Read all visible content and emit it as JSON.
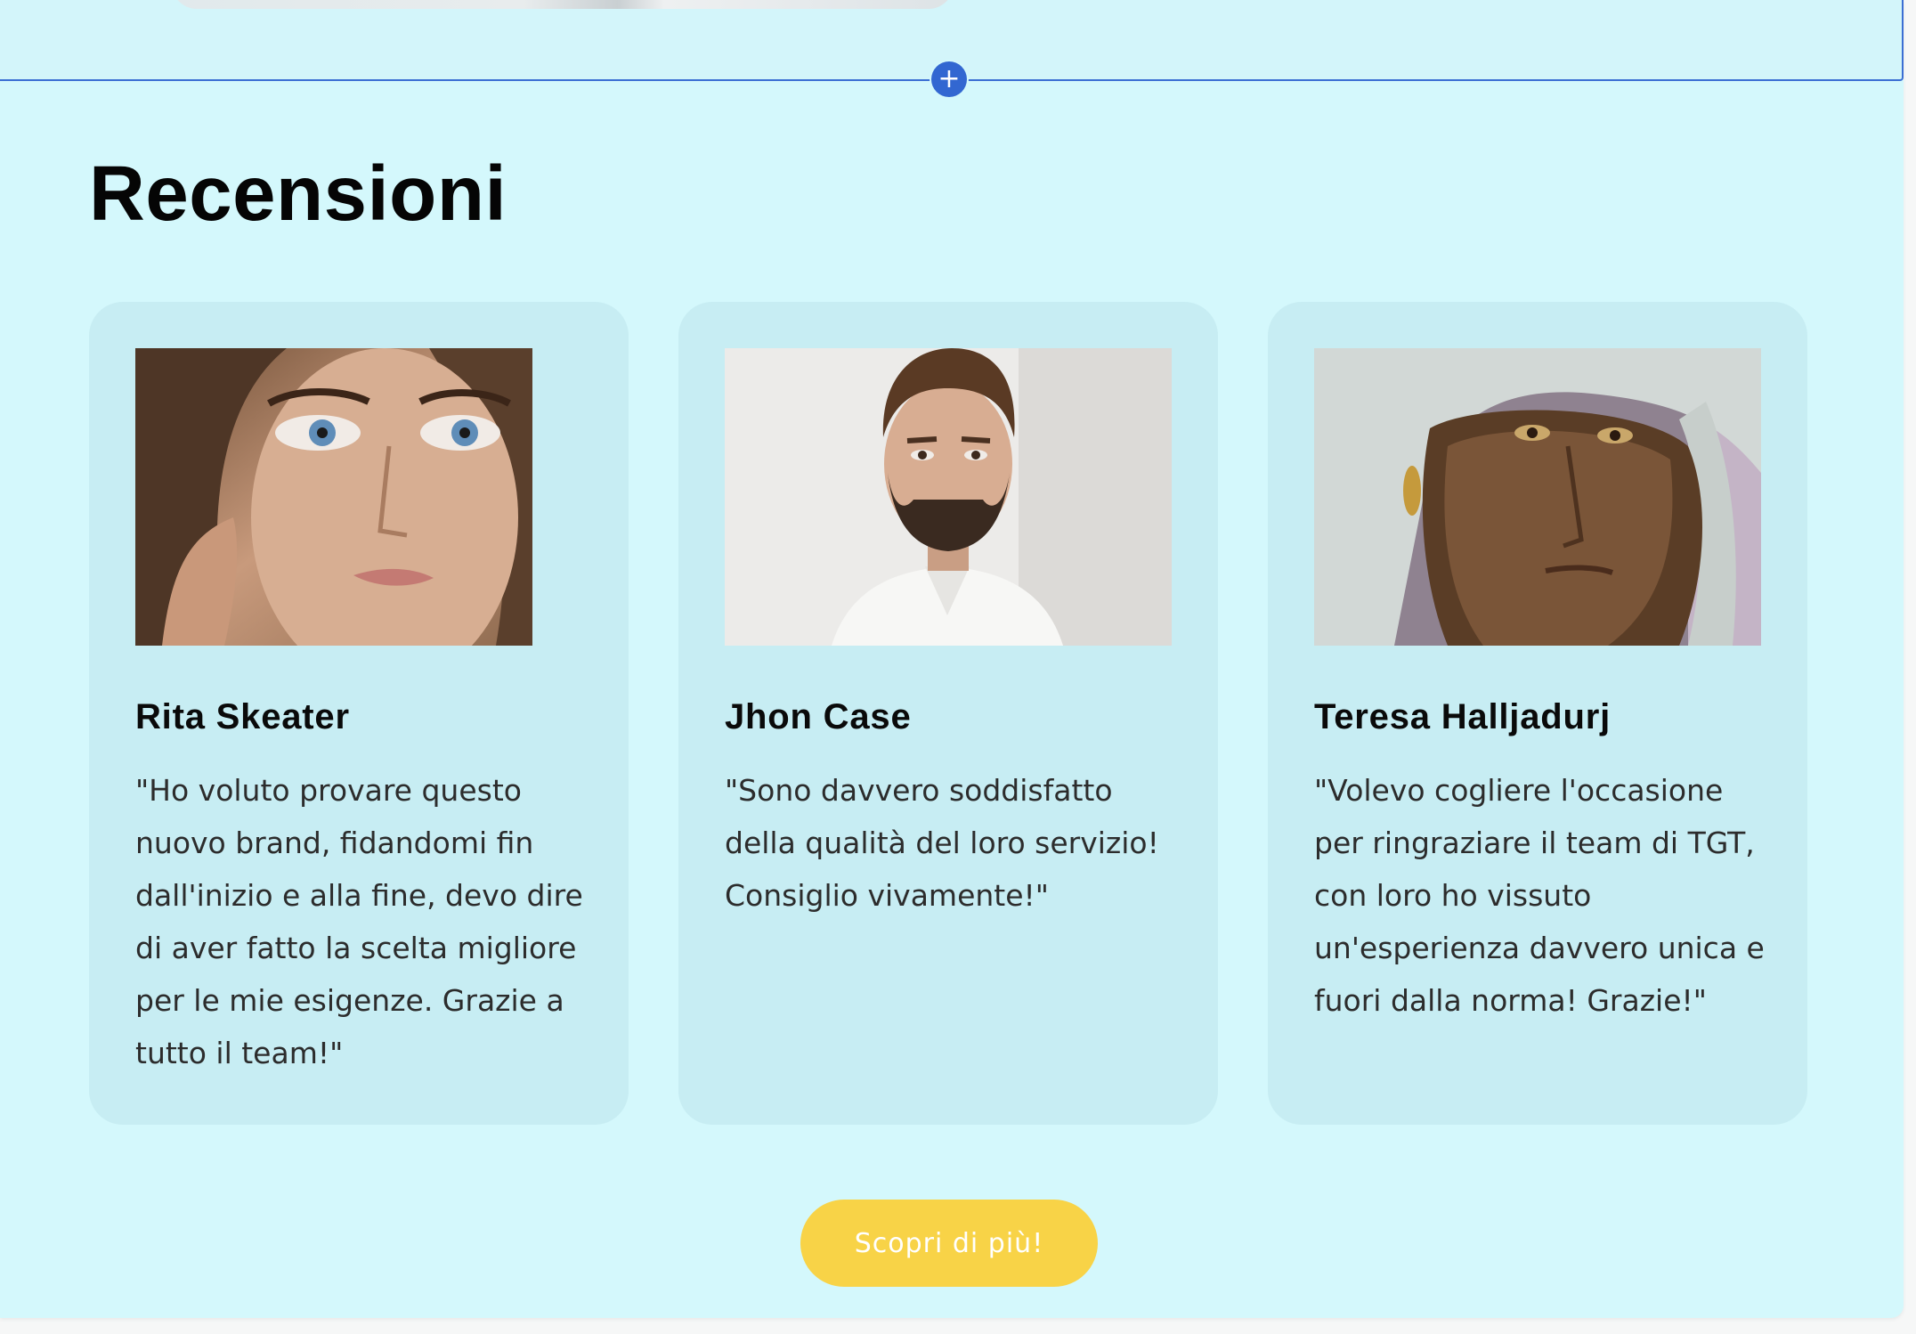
{
  "reviews": {
    "title": "Recensioni",
    "cards": [
      {
        "name": "Rita Skeater",
        "quote": "\"Ho voluto provare questo nuovo brand, fidandomi fin dall'inizio e alla fine, devo dire di aver fatto la scelta migliore per le mie esigenze. Grazie a tutto il team!\""
      },
      {
        "name": "Jhon Case",
        "quote": "\"Sono davvero soddisfatto della qualità del loro servizio! Consiglio vivamente!\""
      },
      {
        "name": "Teresa Halljadurj",
        "quote": "\"Volevo cogliere l'occasione per ringraziare il team di TGT, con loro ho vissuto un'esperienza davvero unica e fuori dalla norma! Grazie!\""
      }
    ],
    "cta_label": "Scopri di più!"
  },
  "editor": {
    "add_section_icon": "plus-icon"
  },
  "colors": {
    "section_background": "#d4f8fc",
    "card_background": "#c7edf3",
    "cta_background": "#f8d347",
    "editor_accent": "#3267d1"
  }
}
